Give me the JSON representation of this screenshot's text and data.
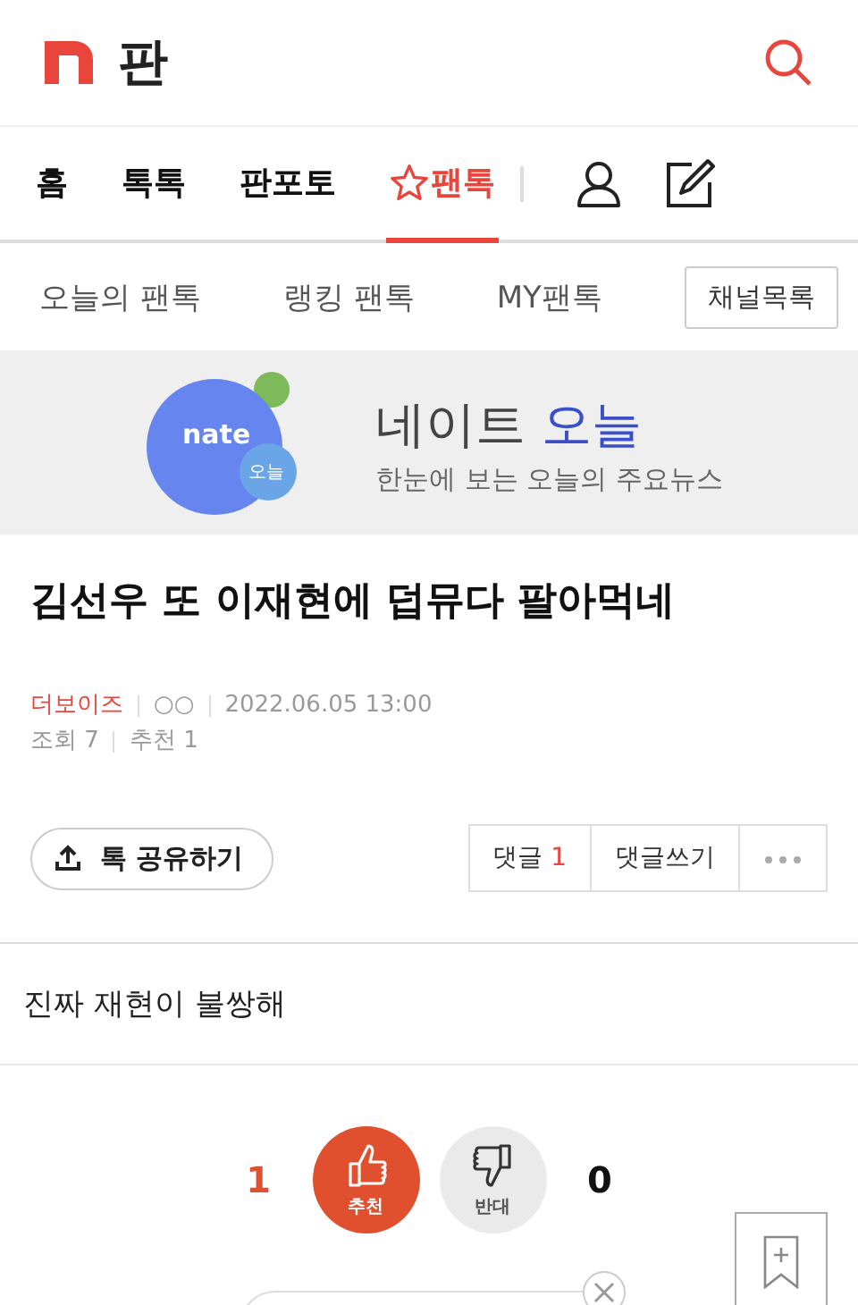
{
  "header": {
    "logo_letter": "판"
  },
  "nav_tabs": [
    {
      "label": "홈",
      "selected": false,
      "starred": false
    },
    {
      "label": "톡톡",
      "selected": false,
      "starred": false
    },
    {
      "label": "판포토",
      "selected": false,
      "starred": false
    },
    {
      "label": "팬톡",
      "selected": true,
      "starred": true
    }
  ],
  "sub_tabs": [
    "오늘의 팬톡",
    "랭킹 팬톡",
    "MY팬톡"
  ],
  "channel_button": "채널목록",
  "banner": {
    "logo_text": "nate",
    "logo_badge": "오늘",
    "title": "네이트",
    "title_highlight": "오늘",
    "subtitle": "한눈에 보는 오늘의 주요뉴스"
  },
  "post": {
    "title": "김선우 또 이재현에 덥뮤다 팔아먹네",
    "channel": "더보이즈",
    "author": "○○",
    "date": "2022.06.05 13:00",
    "views_label": "조회",
    "views": "7",
    "recommends_label": "추천",
    "recommends": "1",
    "body": "진짜 재현이 불쌍해"
  },
  "share_button": "톡 공유하기",
  "comment_buttons": {
    "comments_label": "댓글",
    "comments_count": "1",
    "write": "댓글쓰기"
  },
  "votes": [
    {
      "kind": "up",
      "count": "1",
      "label": "추천",
      "active": true
    },
    {
      "kind": "down",
      "count": "0",
      "label": "반대",
      "active": false
    }
  ]
}
